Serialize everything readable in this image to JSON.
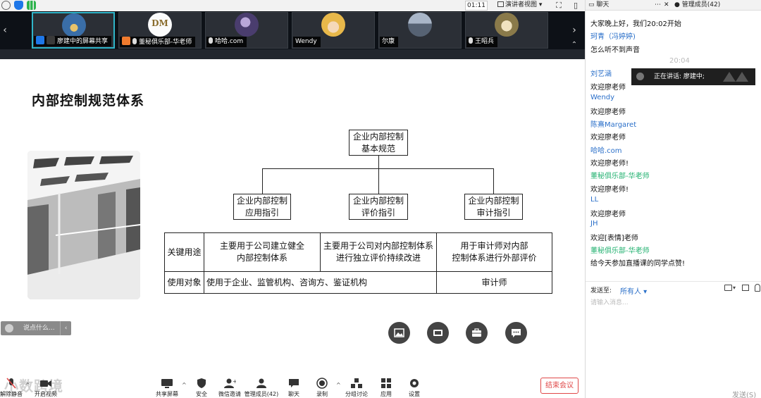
{
  "topbar": {
    "timer": "01:11",
    "view_mode": "演讲者视图"
  },
  "strip": {
    "tiles": [
      {
        "label": "廖建中的屏幕共享",
        "color": "#3a6ea8"
      },
      {
        "label": "董秘俱乐部-华老师",
        "color": "#f0f0f0"
      },
      {
        "label": "哈哈.com",
        "color": "#6a5a8e"
      },
      {
        "label": "Wendy",
        "color": "#e8b84a"
      },
      {
        "label": "尔康",
        "color": "#7e8ca0"
      },
      {
        "label": "王昭兵",
        "color": "#d8c58a"
      }
    ]
  },
  "slide": {
    "title": "内部控制规范体系",
    "top_box": [
      "企业内部控制",
      "基本规范"
    ],
    "boxes": [
      [
        "企业内部控制",
        "应用指引"
      ],
      [
        "企业内部控制",
        "评价指引"
      ],
      [
        "企业内部控制",
        "审计指引"
      ]
    ],
    "table": {
      "row1_header": "关键用途",
      "row1": [
        [
          "主要用于公司建立健全",
          "内部控制体系"
        ],
        [
          "主要用于公司对内部控制体系",
          "进行独立评价持续改进"
        ],
        [
          "用于审计师对内部",
          "控制体系进行外部评价"
        ]
      ],
      "row2_header": "使用对象",
      "row2_span": "使用于企业、监管机构、咨询方、鉴证机构",
      "row2_last": "审计师"
    },
    "say_placeholder": "说点什么..."
  },
  "toolbar": {
    "watermark": "小数跨境",
    "items": [
      {
        "label": "解除静音"
      },
      {
        "label": "开启视频"
      },
      {
        "label": "共享屏幕"
      },
      {
        "label": "安全"
      },
      {
        "label": "微信邀请"
      },
      {
        "label": "管理成员(42)"
      },
      {
        "label": "聊天"
      },
      {
        "label": "录制"
      },
      {
        "label": "分组讨论"
      },
      {
        "label": "应用"
      },
      {
        "label": "设置"
      }
    ],
    "end_label": "结束会议"
  },
  "chat": {
    "tab_chat": "聊天",
    "tab_members": "管理成员(42)",
    "messages": [
      {
        "text": "大家晚上好，我们20:02开始"
      },
      {
        "name": "珂青（冯婷婷)"
      },
      {
        "text": "怎么听不到声音"
      },
      {
        "name": "刘艺涵"
      },
      {
        "text": "欢迎廖老师"
      },
      {
        "name": "Wendy"
      },
      {
        "text": "欢迎廖老师"
      },
      {
        "name": "陈熹Margaret"
      },
      {
        "text": "欢迎廖老师"
      },
      {
        "name": "哈哈.com"
      },
      {
        "text": "欢迎廖老师!"
      },
      {
        "name": "董秘俱乐部-华老师"
      },
      {
        "text": "欢迎廖老师!"
      },
      {
        "name": "LL"
      },
      {
        "text": "欢迎廖老师"
      },
      {
        "name": "JH"
      },
      {
        "text": "欢迎[表情]老师"
      },
      {
        "name": "董秘俱乐部-华老师"
      },
      {
        "text": "给今天参加直播课的同学点赞!"
      }
    ],
    "time": "20:04",
    "speaking": "正在讲话: 廖建中;",
    "send_to_label": "发送至:",
    "send_to_value": "所有人",
    "input_placeholder": "请输入消息...",
    "send_label": "发送(S)"
  }
}
